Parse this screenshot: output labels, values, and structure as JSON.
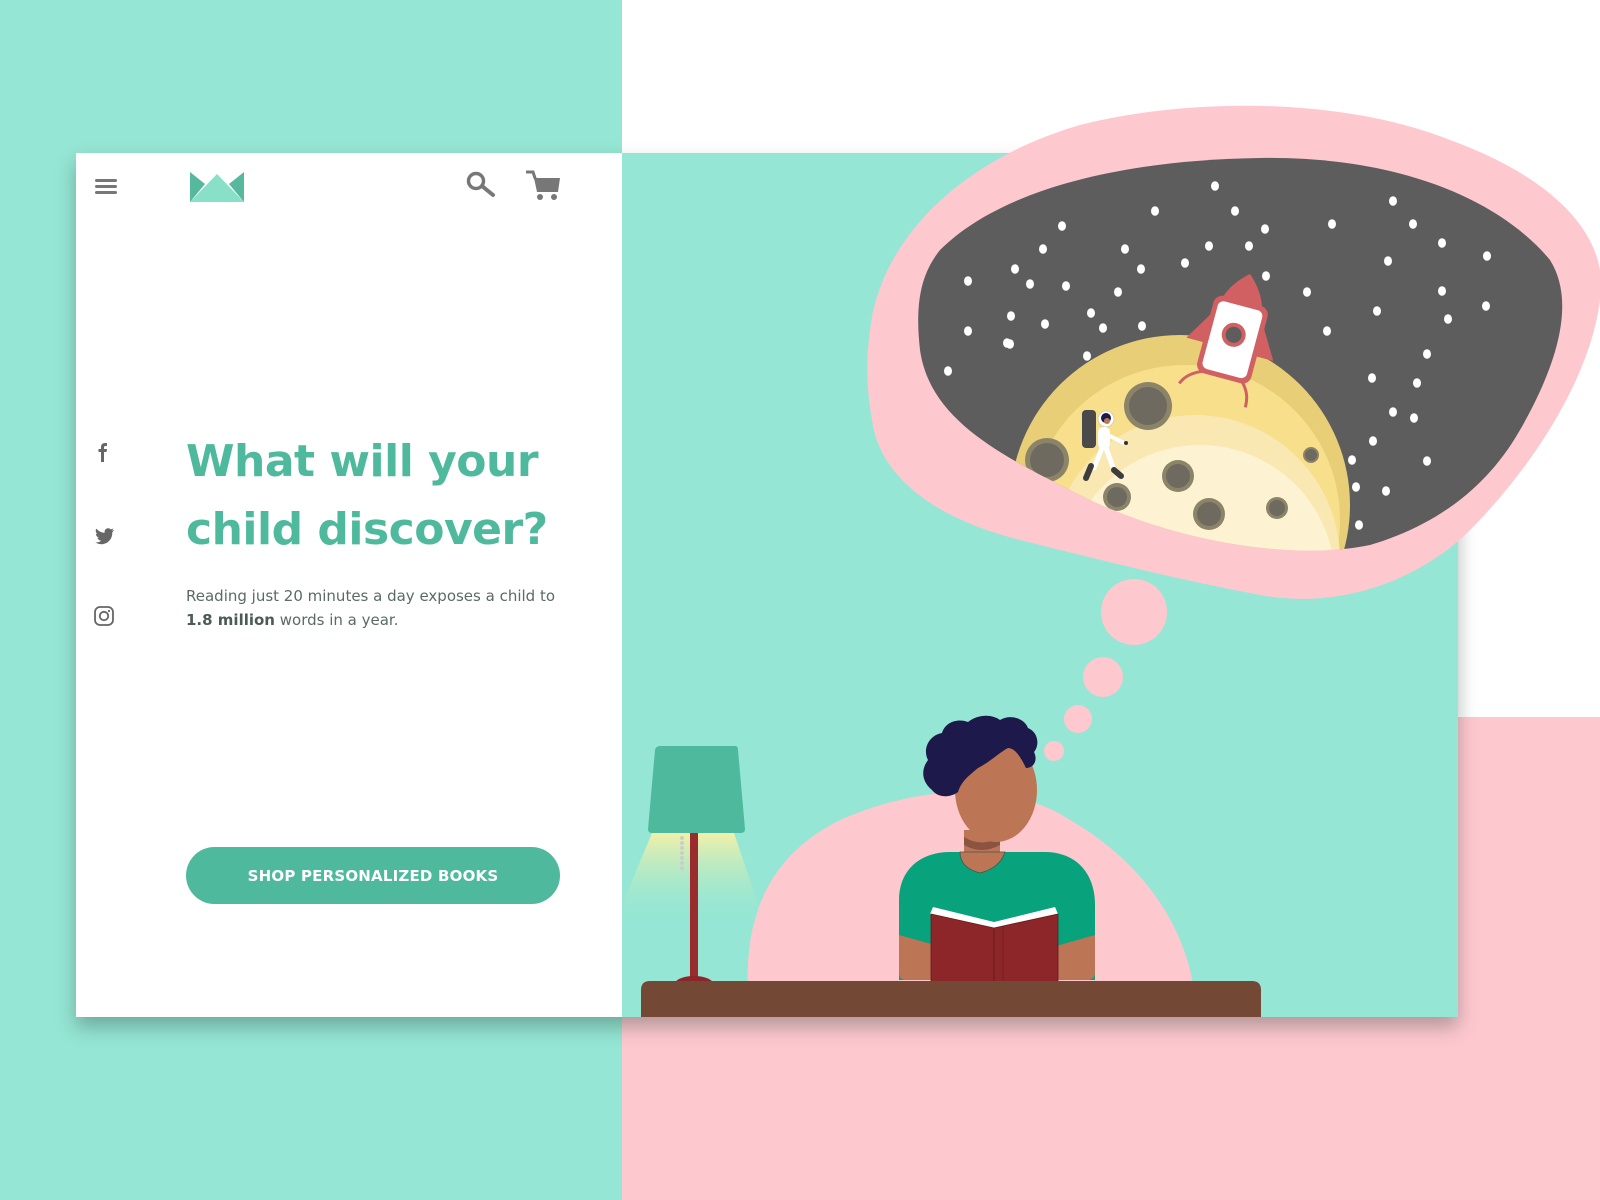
{
  "header": {
    "menu_icon": "hamburger-menu-icon",
    "logo": "crown-logo",
    "search_icon": "search-icon",
    "cart_icon": "cart-icon"
  },
  "social": [
    {
      "name": "facebook",
      "icon": "facebook-icon"
    },
    {
      "name": "twitter",
      "icon": "twitter-icon"
    },
    {
      "name": "instagram",
      "icon": "instagram-icon"
    }
  ],
  "hero": {
    "headline_line1": "What will your",
    "headline_line2": "child discover?",
    "body_pre": "Reading just 20 minutes a day exposes a child to ",
    "body_bold": "1.8 million",
    "body_post": " words in a year.",
    "cta_label": "SHOP PERSONALIZED BOOKS"
  },
  "illustration": {
    "description": "Child reading a book at a desk next to a lamp, dreaming of an astronaut on the moon with a rocket",
    "elements": [
      "thought-bubble",
      "starry-sky",
      "moon",
      "rocket",
      "astronaut",
      "child",
      "book",
      "lamp",
      "desk"
    ]
  },
  "colors": {
    "teal_bg": "#95e6d4",
    "accent_green": "#4fb99e",
    "pink": "#fec8cf",
    "space_gray": "#5d5d5d",
    "moon_yellow": "#f7df8c",
    "rocket_red": "#d06062",
    "book_red": "#8c2628",
    "desk_brown": "#734935",
    "shirt_green": "#08a27c",
    "skin": "#bc7655",
    "hair": "#1d194a"
  }
}
